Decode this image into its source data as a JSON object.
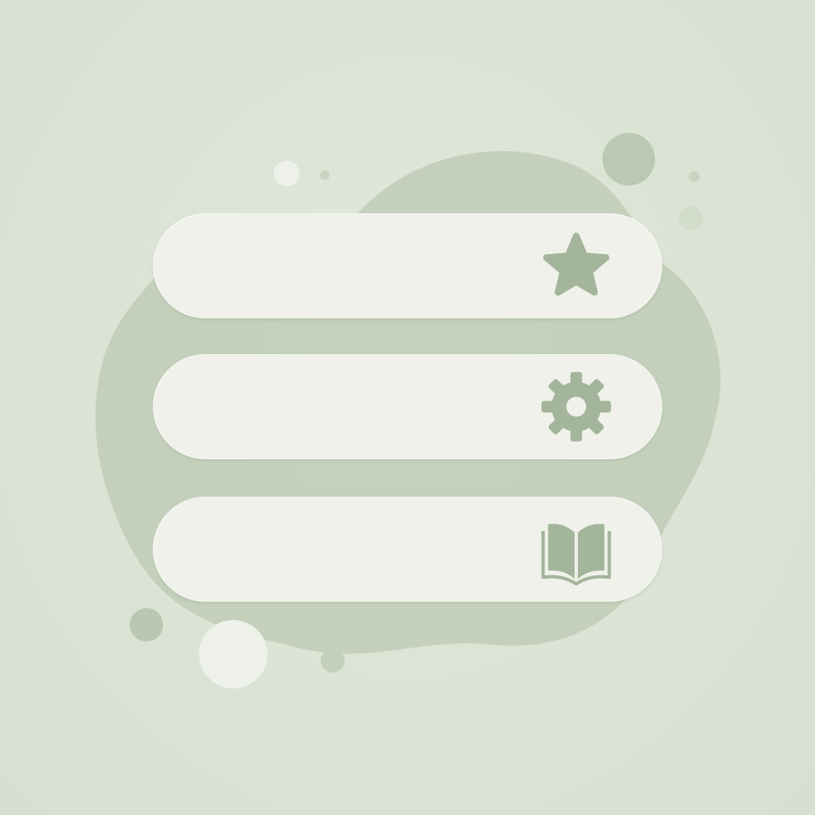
{
  "colors": {
    "background": "#dbe3d5",
    "blob": "#bccbb3",
    "row_fill": "#eff1ea",
    "icon": "#9fb295"
  },
  "menu": {
    "items": [
      {
        "icon": "star-icon",
        "label": ""
      },
      {
        "icon": "gear-icon",
        "label": ""
      },
      {
        "icon": "open-book-icon",
        "label": ""
      }
    ]
  }
}
